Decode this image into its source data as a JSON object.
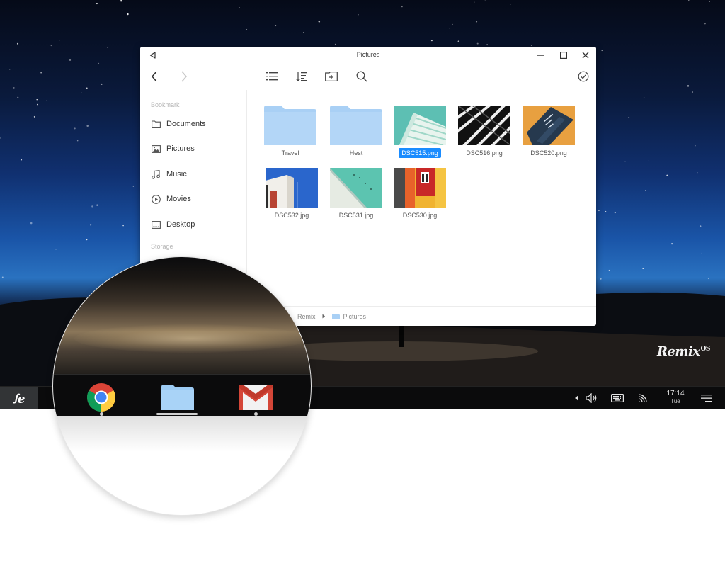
{
  "window": {
    "title": "Pictures"
  },
  "sidebar": {
    "bookmark_heading": "Bookmark",
    "storage_heading": "Storage",
    "items": [
      {
        "label": "Documents",
        "icon": "folder-outline-icon"
      },
      {
        "label": "Pictures",
        "icon": "image-icon"
      },
      {
        "label": "Music",
        "icon": "music-note-icon"
      },
      {
        "label": "Movies",
        "icon": "play-circle-icon"
      },
      {
        "label": "Desktop",
        "icon": "desktop-icon"
      }
    ]
  },
  "files": [
    {
      "name": "Travel",
      "kind": "folder"
    },
    {
      "name": "Hest",
      "kind": "folder"
    },
    {
      "name": "DSC515.png",
      "kind": "image",
      "selected": true
    },
    {
      "name": "DSC516.png",
      "kind": "image"
    },
    {
      "name": "DSC520.png",
      "kind": "image"
    },
    {
      "name": "DSC532.jpg",
      "kind": "image"
    },
    {
      "name": "DSC531.jpg",
      "kind": "image"
    },
    {
      "name": "DSC530.jpg",
      "kind": "image"
    }
  ],
  "pathbar": {
    "root": "Remix",
    "current": "Pictures"
  },
  "taskbar": {
    "start_logo": "ꭍe",
    "clock_time": "17:14",
    "clock_day": "Tue"
  },
  "dock": {
    "apps": [
      {
        "name": "Chrome",
        "icon": "chrome-icon"
      },
      {
        "name": "Files",
        "icon": "files-folder-icon"
      },
      {
        "name": "Gmail",
        "icon": "gmail-icon"
      }
    ]
  },
  "wallpaper_logo": "Remix",
  "wallpaper_logo_suffix": "OS",
  "colors": {
    "accent": "#1a8cff",
    "folder": "#a9d0f5",
    "taskbar": "#0b0b0c"
  }
}
